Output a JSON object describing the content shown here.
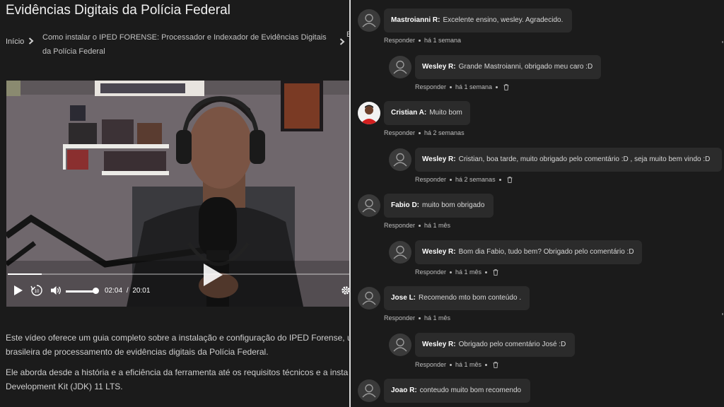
{
  "page": {
    "title": "Evidências Digitais da Polícia Federal",
    "breadcrumb": {
      "home": "Início",
      "current": "Como instalar o IPED FORENSE: Processador e Indexador de Evidências Digitais da Polícia Federal",
      "next_partial": "E"
    }
  },
  "video": {
    "current_time": "02:04",
    "separator": "/",
    "duration": "20:01",
    "progress": 0.1,
    "volume": 0.95
  },
  "description": {
    "p1_line1": "Este vídeo oferece um guia completo sobre a instalação e configuração do IPED Forense, u",
    "p1_line2": "brasileira de processamento de evidências digitais da Polícia Federal.",
    "p2_line1": "Ele aborda desde a história e a eficiência da ferramenta até os requisitos técnicos e a insta",
    "p2_line2": "Development Kit (JDK) 11 LTS."
  },
  "comments": [
    {
      "author": "Mastroianni R:",
      "text": "Excelente ensino, wesley. Agradecido.",
      "reply_label": "Responder",
      "age": "há 1 semana",
      "reply": false,
      "deletable": false
    },
    {
      "author": "Wesley R:",
      "text": "Grande Mastroianni, obrigado meu caro :D",
      "reply_label": "Responder",
      "age": "há 1 semana",
      "reply": true,
      "deletable": true
    },
    {
      "author": "Cristian A:",
      "text": "Muito bom",
      "reply_label": "Responder",
      "age": "há 2 semanas",
      "reply": false,
      "deletable": false,
      "avatar": "photo"
    },
    {
      "author": "Wesley R:",
      "text": "Cristian, boa tarde, muito obrigado pelo comentário :D , seja muito bem vindo :D",
      "reply_label": "Responder",
      "age": "há 2 semanas",
      "reply": true,
      "deletable": true
    },
    {
      "author": "Fabio D:",
      "text": "muito bom obrigado",
      "reply_label": "Responder",
      "age": "há 1 mês",
      "reply": false,
      "deletable": false
    },
    {
      "author": "Wesley R:",
      "text": "Bom dia Fabio, tudo bem? Obrigado pelo comentário :D",
      "reply_label": "Responder",
      "age": "há 1 mês",
      "reply": true,
      "deletable": true
    },
    {
      "author": "Jose L:",
      "text": "Recomendo mto bom conteúdo .",
      "reply_label": "Responder",
      "age": "há 1 mês",
      "reply": false,
      "deletable": false
    },
    {
      "author": "Wesley R:",
      "text": "Obrigado pelo comentário José :D",
      "reply_label": "Responder",
      "age": "há 1 mês",
      "reply": true,
      "deletable": true
    },
    {
      "author": "Joao R:",
      "text": "conteudo muito bom recomendo",
      "reply_label": "",
      "age": "",
      "reply": false,
      "deletable": false
    }
  ],
  "icons": {
    "breadcrumb_separator": "chevron-right-icon",
    "play": "play-icon",
    "rewind": "rewind-10-icon",
    "volume": "volume-icon",
    "settings": "gear-icon",
    "avatar": "user-icon",
    "delete": "trash-icon"
  },
  "colors": {
    "background": "#1b1b1b",
    "bubble": "#2b2b2b",
    "divider": "#d9d9d9",
    "text_primary": "#ffffff",
    "text_secondary": "#bdbdbd"
  }
}
